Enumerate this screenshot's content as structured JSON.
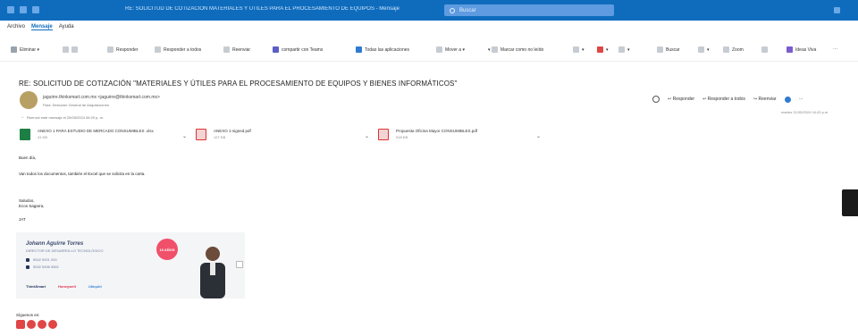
{
  "window": {
    "title": "RE: SOLICITUD DE COTIZACIÓN MATERIALES Y ÚTILES PARA EL PROCESAMIENTO DE EQUIPOS - Mensaje",
    "search_label": "Buscar"
  },
  "menu": [
    "Archivo",
    "Mensaje",
    "Ayuda"
  ],
  "ribbon": {
    "delete": "Eliminar",
    "reply": "Responder",
    "reply_all": "Responder a todos",
    "forward": "Reenviar",
    "teams": "compartir con Teams",
    "apps": "Todas las aplicaciones",
    "move": "Mover a",
    "mark_unread": "Marcar como no leído",
    "search": "Buscar",
    "zoom": "Zoom",
    "ideas": "Ideas Viva",
    "more": "···"
  },
  "message": {
    "subject": "RE: SOLICITUD DE COTIZACIÓN \"MATERIALES Y ÚTILES PARA EL PROCESAMIENTO DE EQUIPOS Y BIENES INFORMÁTICOS\"",
    "sender": "jaguirre.thinksmart.com.mx <jaguirre@thinksmart.com.mx>",
    "to": "Para: Dirección General de Adquisiciones",
    "forwarded_note": "Reenvió este mensaje el 25/05/2024 06:29 p. m.",
    "date": "martes 21/05/2024 04:43 p.m.",
    "actions": {
      "reply": "Responder",
      "reply_all": "Responder a todos",
      "forward": "Reenviar",
      "more": "···"
    }
  },
  "attachments": [
    {
      "name": "ANEXO 1 PARA ESTUDIO DE MERCADO CONSUMIBLES .xlsx",
      "size": "41 KB",
      "icon": "excel-icon"
    },
    {
      "name": "ANEXO 1-signed.pdf",
      "size": "127 KB",
      "icon": "pdf-icon"
    },
    {
      "name": "Propuesta Oficina Mayor CONSUMIBLES.pdf",
      "size": "918 KB",
      "icon": "pdf-icon"
    }
  ],
  "body": {
    "greeting": "Buen día,",
    "line1": "Van todos los documentos, también el Excel que se solicita en la carta.",
    "closing": "Saludos,",
    "team": "Ecos Sagarra,",
    "initials": "JAT"
  },
  "signature": {
    "name": "Johann Aguirre Torres",
    "role": "DIRECTOR DE DESARROLLO TECNOLÓGICO",
    "phone1": "5542 9921 000",
    "phone2": "5532 5456 5561",
    "brands": [
      "ThinkSmart",
      "Honeywell",
      "Ubiquiti"
    ],
    "badge": "10 AÑOS"
  },
  "footer": {
    "follow": "Síguenos en:",
    "social_icons": [
      "youtube-icon",
      "linkedin-icon",
      "facebook-icon",
      "instagram-icon"
    ]
  },
  "colors": {
    "titlebar": "#0f6cbd",
    "accent": "#2f7bd1",
    "flag": "#e04646"
  }
}
